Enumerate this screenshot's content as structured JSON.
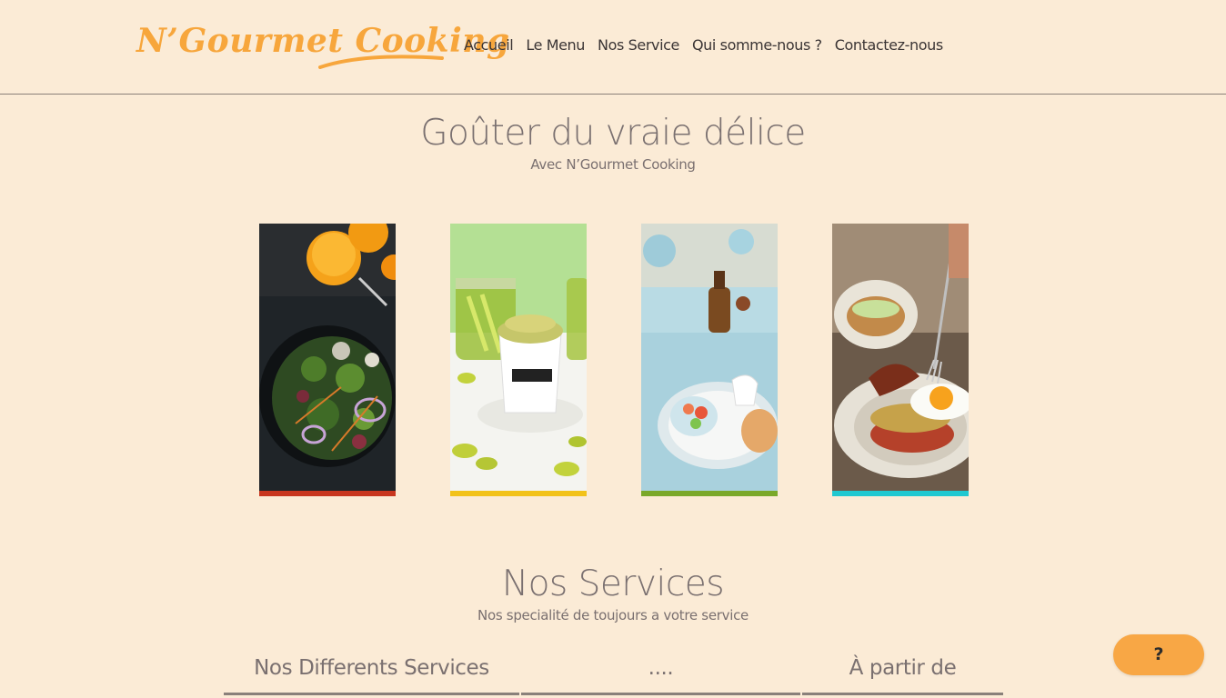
{
  "brand": {
    "logo_text": "N’Gourmet Cooking",
    "color": "#f7a63c"
  },
  "nav": {
    "items": [
      "Accueil",
      "Le Menu",
      "Nos Service",
      "Qui somme-nous ?",
      "Contactez-nous"
    ]
  },
  "hero": {
    "title": "Goûter du vraie délice",
    "subtitle": "Avec N’Gourmet Cooking"
  },
  "gallery": [
    {
      "name": "salad-with-orange-juice",
      "accent": "#c8361f"
    },
    {
      "name": "pickles-dough-cup",
      "accent": "#f2c21a"
    },
    {
      "name": "plated-fish-table",
      "accent": "#7aa82a"
    },
    {
      "name": "bacon-egg-plate",
      "accent": "#1fc8d0"
    }
  ],
  "services": {
    "title": "Nos Services",
    "subtitle": "Nos specialité de toujours a votre service",
    "columns": [
      "Nos Differents Services",
      "....",
      "À partir de"
    ]
  },
  "help_button": {
    "label": "?",
    "color": "#f8a745"
  },
  "colors": {
    "background": "#fbebd6",
    "text": "#7a7070"
  }
}
